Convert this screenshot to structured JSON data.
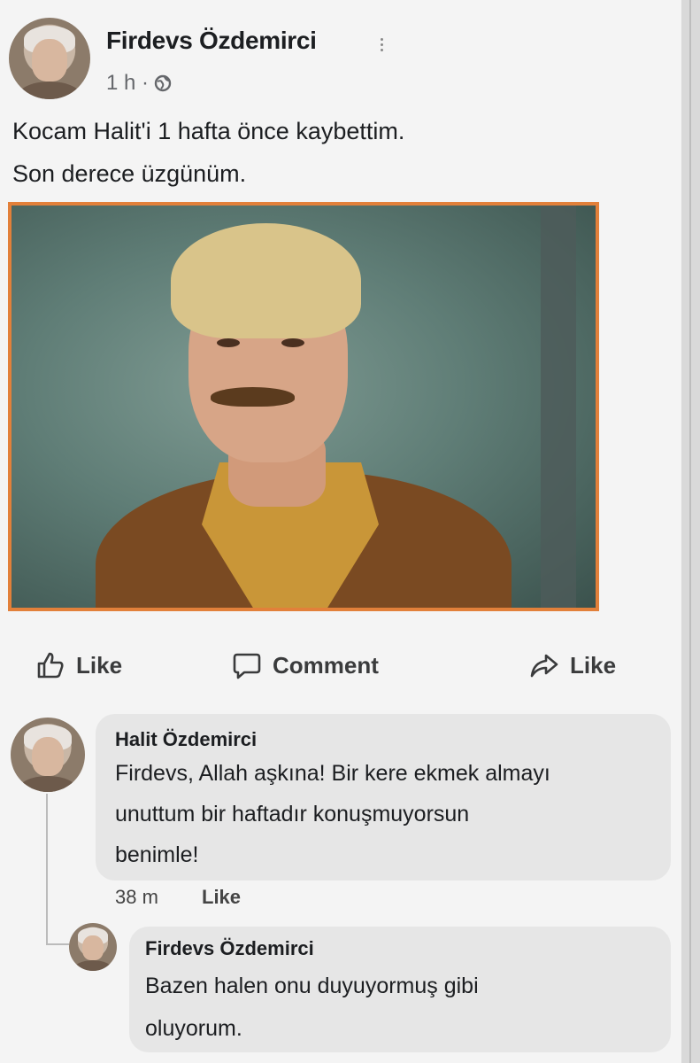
{
  "post": {
    "author": "Firdevs Özdemirci",
    "time": "1 h ·",
    "text_line1": "Kocam Halit'i 1 hafta önce kaybettim.",
    "text_line2": "Son derece üzgünüm."
  },
  "actions": {
    "like_label": "Like",
    "comment_label": "Comment",
    "share_label": "Like"
  },
  "comments": [
    {
      "author": "Halit Özdemirci",
      "lines": [
        "Firdevs, Allah aşkına! Bir kere ekmek almayı",
        "unuttum bir haftadır konuşmuyorsun",
        "benimle!"
      ],
      "time": "38 m",
      "like_label": "Like"
    },
    {
      "author": "Firdevs Özdemirci",
      "lines": [
        "Bazen halen onu duyuyormuş gibi",
        "oluyorum."
      ]
    }
  ],
  "icons": {
    "more": "more-icon",
    "audience": "globe-icon",
    "like": "thumbs-up-icon",
    "comment": "comment-icon",
    "share": "share-icon"
  },
  "colors": {
    "photo_frame": "#e2803a",
    "bubble": "#e6e6e6"
  }
}
